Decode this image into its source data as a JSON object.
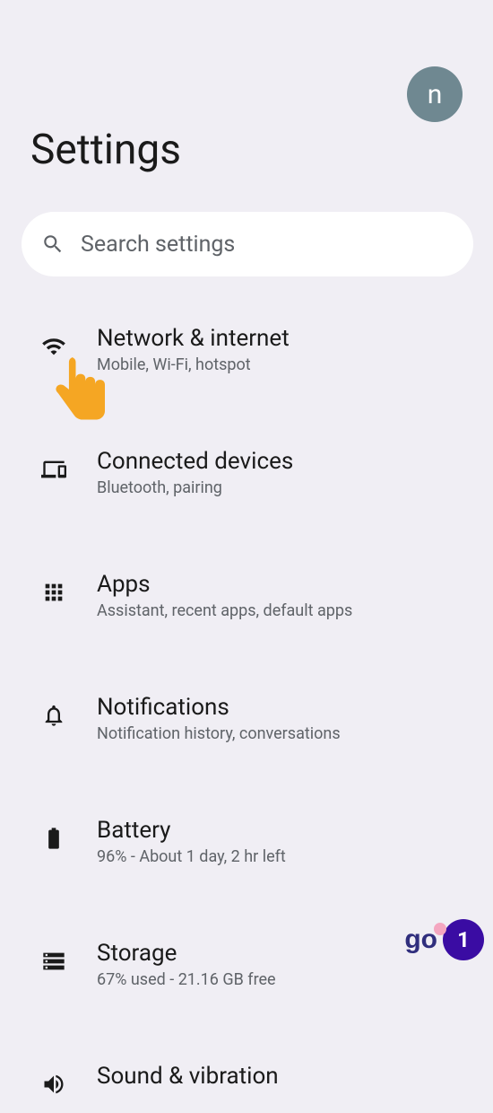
{
  "header": {
    "avatar_letter": "n",
    "page_title": "Settings"
  },
  "search": {
    "placeholder": "Search settings"
  },
  "settings": [
    {
      "icon": "wifi-icon",
      "title": "Network & internet",
      "subtitle": "Mobile, Wi-Fi, hotspot"
    },
    {
      "icon": "devices-icon",
      "title": "Connected devices",
      "subtitle": "Bluetooth, pairing"
    },
    {
      "icon": "apps-icon",
      "title": "Apps",
      "subtitle": "Assistant, recent apps, default apps"
    },
    {
      "icon": "bell-icon",
      "title": "Notifications",
      "subtitle": "Notification history, conversations"
    },
    {
      "icon": "battery-icon",
      "title": "Battery",
      "subtitle": "96% - About 1 day, 2 hr left"
    },
    {
      "icon": "storage-icon",
      "title": "Storage",
      "subtitle": "67% used - 21.16 GB free"
    },
    {
      "icon": "volume-icon",
      "title": "Sound & vibration",
      "subtitle": ""
    }
  ],
  "overlay": {
    "logo_text": "go",
    "step_number": "1"
  }
}
